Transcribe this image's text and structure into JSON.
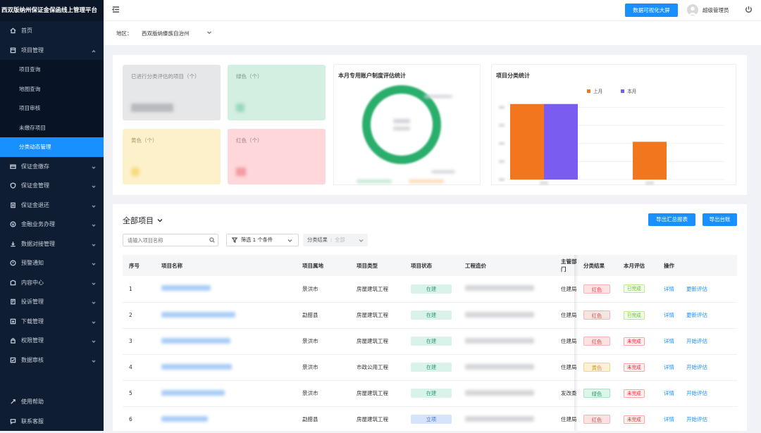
{
  "app": {
    "title": "西双版纳州保证金保函线上管理平台"
  },
  "sidebar": {
    "items": [
      {
        "label": "首页",
        "icon": "home-icon"
      },
      {
        "label": "项目管理",
        "icon": "project-icon",
        "expanded": true
      },
      {
        "label": "保证金缴存",
        "icon": "deposit-icon"
      },
      {
        "label": "保证金管理",
        "icon": "shield-icon"
      },
      {
        "label": "保证金退还",
        "icon": "refund-icon"
      },
      {
        "label": "金融业务办理",
        "icon": "finance-icon"
      },
      {
        "label": "数据对接管理",
        "icon": "data-link-icon"
      },
      {
        "label": "预警通知",
        "icon": "alert-icon"
      },
      {
        "label": "内容中心",
        "icon": "content-icon"
      },
      {
        "label": "投诉管理",
        "icon": "complaint-icon"
      },
      {
        "label": "下载管理",
        "icon": "download-icon"
      },
      {
        "label": "权限管理",
        "icon": "lock-icon"
      },
      {
        "label": "数据审核",
        "icon": "audit-icon"
      }
    ],
    "sub_items": [
      "项目查询",
      "地图查询",
      "项目审核",
      "未缴存项目",
      "分类动态管理"
    ],
    "active_sub": "分类动态管理",
    "bottom": [
      {
        "label": "使用帮助",
        "icon": "help-icon"
      },
      {
        "label": "联系客服",
        "icon": "chat-icon"
      }
    ]
  },
  "topbar": {
    "dashboard_button": "数据可视化大屏",
    "user_name": "超级管理员"
  },
  "region": {
    "label": "地区：",
    "value": "西双版纳傣族自治州"
  },
  "stats": {
    "card_evaluated": {
      "label": "已进行分类评估的项目（个）",
      "color": "#e6e7e9"
    },
    "card_green": {
      "label": "绿色（个）",
      "color": "#d3efe2"
    },
    "card_yellow": {
      "label": "黄色（个）",
      "color": "#fdf1cc"
    },
    "card_red": {
      "label": "红色（个）",
      "color": "#fdd7d9"
    },
    "donut_title": "本月专用账户制度评估统计",
    "bar_title": "项目分类统计",
    "legend_last_month": "上月",
    "legend_this_month": "本月"
  },
  "chart_data": {
    "type": "bar",
    "categories": [
      "",
      ""
    ],
    "series": [
      {
        "name": "上月",
        "values": [
          5,
          2.5
        ],
        "color": "#f2761e"
      },
      {
        "name": "本月",
        "values": [
          5,
          0
        ],
        "color": "#7b5cf0"
      }
    ],
    "title": "项目分类统计",
    "xlabel": "",
    "ylabel": "",
    "ylim": [
      0,
      5.5
    ],
    "legend": "top-center"
  },
  "main": {
    "title": "全部项目",
    "export_summary": "导出汇总报表",
    "export_ledger": "导出台账",
    "search_placeholder": "请输入项目名称",
    "filter_label": "筛选 1 个条件",
    "class_result_label": "分类结果",
    "class_result_value": "全部",
    "columns": [
      "序号",
      "项目名称",
      "项目属地",
      "项目类型",
      "项目状态",
      "工程造价",
      "主管部门",
      "分类结果",
      "本月评估",
      "操作"
    ],
    "rows": [
      {
        "no": "1",
        "region": "景洪市",
        "type": "房屋建筑工程",
        "status": "在建",
        "status_kind": "jian",
        "dept": "住建局",
        "class": "红色",
        "class_kind": "red",
        "eval": "已完成",
        "eval_kind": "done",
        "action1": "详情",
        "action2": "更新评估"
      },
      {
        "no": "2",
        "region": "勐腊县",
        "type": "房屋建筑工程",
        "status": "在建",
        "status_kind": "jian",
        "dept": "住建局",
        "class": "红色",
        "class_kind": "red",
        "eval": "已完成",
        "eval_kind": "done",
        "action1": "详情",
        "action2": "更新评估"
      },
      {
        "no": "3",
        "region": "景洪市",
        "type": "房屋建筑工程",
        "status": "在建",
        "status_kind": "jian",
        "dept": "住建局",
        "class": "红色",
        "class_kind": "red",
        "eval": "未完成",
        "eval_kind": "undone",
        "action1": "详情",
        "action2": "开始评估"
      },
      {
        "no": "4",
        "region": "景洪市",
        "type": "市政公用工程",
        "status": "在建",
        "status_kind": "jian",
        "dept": "住建局",
        "class": "黄色",
        "class_kind": "yellow",
        "eval": "未完成",
        "eval_kind": "undone",
        "action1": "详情",
        "action2": "开始评估"
      },
      {
        "no": "5",
        "region": "景洪市",
        "type": "房屋建筑工程",
        "status": "在建",
        "status_kind": "jian",
        "dept": "发改委",
        "class": "绿色",
        "class_kind": "green",
        "eval": "未完成",
        "eval_kind": "undone",
        "action1": "详情",
        "action2": "开始评估"
      },
      {
        "no": "6",
        "region": "勐腊县",
        "type": "房屋建筑工程",
        "status": "立项",
        "status_kind": "li",
        "dept": "住建局",
        "class": "红色",
        "class_kind": "red",
        "eval": "未完成",
        "eval_kind": "undone",
        "action1": "详情",
        "action2": "开始评估"
      }
    ]
  }
}
